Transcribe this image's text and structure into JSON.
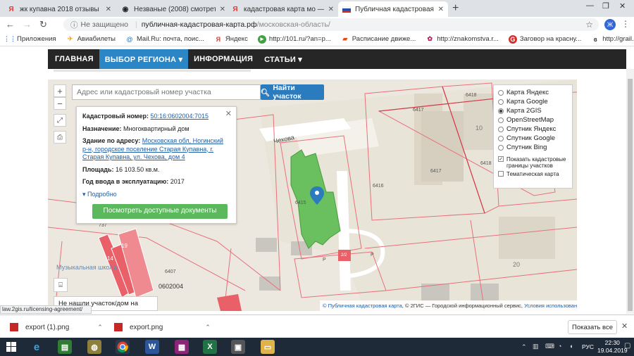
{
  "tabs": [
    {
      "title": "жк купавна 2018 отзывы покуп",
      "favicon": "Я",
      "color": "#e53935"
    },
    {
      "title": "Незваные (2008) смотреть онла",
      "favicon": "◉",
      "color": "#222222"
    },
    {
      "title": "кадастровая карта мо — Яндекс",
      "favicon": "Я",
      "color": "#e53935"
    },
    {
      "title": "Публичная кадастровая карта",
      "favicon": "■",
      "color": "#d32f2f"
    }
  ],
  "address": {
    "security": "Не защищено",
    "host": "публичная-кадастровая-карта.рф",
    "path": "/московская-область/"
  },
  "bookmarks": [
    {
      "label": "Приложения",
      "icon": "apps-icon"
    },
    {
      "label": "Авиабилеты",
      "icon": "plane-icon"
    },
    {
      "label": "Mail.Ru: почта, поис...",
      "icon": "mail-icon"
    },
    {
      "label": "Яндекс",
      "icon": "yandex-icon"
    },
    {
      "label": "http://101.ru/?an=p...",
      "icon": "play-icon"
    },
    {
      "label": "Расписание движе...",
      "icon": "train-icon"
    },
    {
      "label": "http://znakomstva.r...",
      "icon": "flower-icon"
    },
    {
      "label": "Заговор на красну...",
      "icon": "g-icon"
    },
    {
      "label": "http://grail.chudofo...",
      "icon": "swirl-icon"
    }
  ],
  "site_nav": [
    "ГЛАВНАЯ",
    "ВЫБОР РЕГИОНА ▾",
    "ИНФОРМАЦИЯ",
    "СТАТЬИ ▾"
  ],
  "search": {
    "placeholder": "Адрес или кадастровый номер участка",
    "button": "Найти участок"
  },
  "info": {
    "cad_label": "Кадастровый номер:",
    "cad_value": "50:16:0602004:7015",
    "purpose_label": "Назначение:",
    "purpose_value": "Многоквартирный дом",
    "addr_label": "Здание по адресу:",
    "addr_value": "Московская обл, Ногинский р-н, городское поселение Старая Купавна, г. Старая Купавна, ул. Чехова, дом 4",
    "area_label": "Площадь:",
    "area_value": "16 103.50 кв.м.",
    "year_label": "Год ввода в эксплуатацию:",
    "year_value": "2017",
    "more": "▾ Подробно",
    "docs_button": "Посмотреть доступные документы"
  },
  "layers": {
    "options": [
      "Карта Яндекс",
      "Карта Google",
      "Карта 2GIS",
      "OpenStreetMap",
      "Спутник Яндекс",
      "Спутник Google",
      "Спутник Bing"
    ],
    "selected": "Карта 2GIS",
    "check1": "Показать кадастровые границы участков",
    "check2": "Тематическая карта"
  },
  "map_labels": {
    "street": "Чехова",
    "school": "Музыкальная школа",
    "n6417a": "6417",
    "n6418a": "6418",
    "n10": "10",
    "n6418b": "6418",
    "n6417b": "6417",
    "n6416": "6416",
    "n6415": "6415",
    "n6407": "6407",
    "n0602004": "0602004",
    "n20": "20",
    "n19": "19",
    "n737": "737",
    "n14": "14",
    "nP1": "P",
    "nP2": "P",
    "n2b": "2/2"
  },
  "attribution": {
    "link": "Публичная кадастровая карта",
    "text": ", © 2ГИС — Городской информационный сервис,",
    "terms": "Условия использования"
  },
  "not_found": "Не нашли участок/дом на карте?",
  "status_link": "law.2gis.ru/licensing-agreement/",
  "downloads": [
    {
      "name": "export (1).png"
    },
    {
      "name": "export.png"
    }
  ],
  "show_all": "Показать все",
  "clock": {
    "time": "22:30",
    "date": "19.04.2019"
  },
  "lang": "РУС",
  "colors": {
    "nav_bg": "#262626",
    "nav_active": "#2b86c5",
    "parcel_line": "#e8707a",
    "building_green": "#6abf5e",
    "docs_button": "#5cb85c"
  }
}
